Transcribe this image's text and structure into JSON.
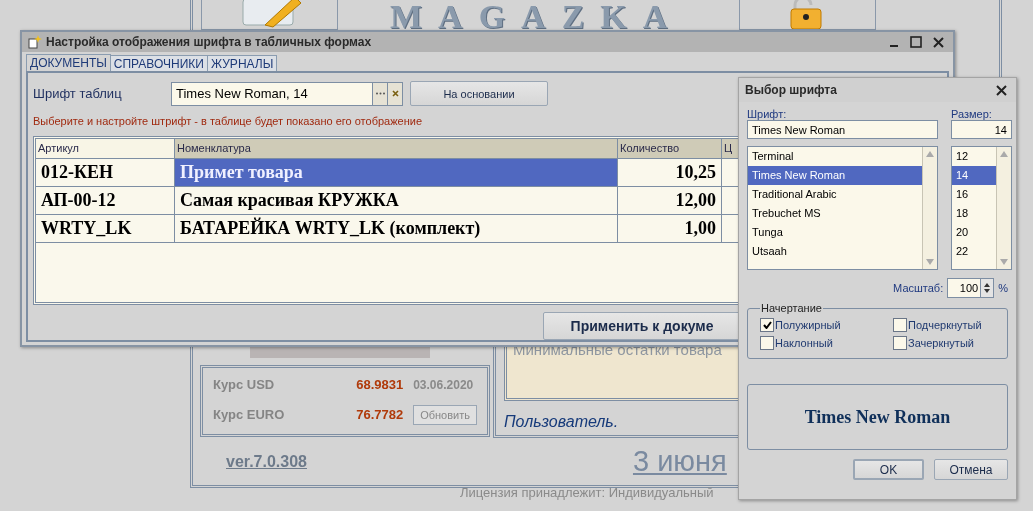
{
  "background_app": {
    "logo": "MAGAZKA",
    "currency": [
      {
        "label": "Курс USD",
        "rate": "68.9831",
        "date": "03.06.2020"
      },
      {
        "label": "Курс EURO",
        "rate": "76.7782"
      }
    ],
    "refresh_button": "Обновить",
    "notice": "Минимальные остатки товара",
    "user": "Пользователь.",
    "version": "ver.7.0.308",
    "date": "3 июня",
    "license": "Лицензия принадлежит: Индивидуальный"
  },
  "main_dialog": {
    "title": "Настройка отображения шрифта в табличных формах",
    "tabs": [
      {
        "label": "ДОКУМЕНТЫ",
        "selected": true
      },
      {
        "label": "СПРАВОЧНИКИ",
        "selected": false
      },
      {
        "label": "ЖУРНАЛЫ",
        "selected": false
      }
    ],
    "font_label": "Шрифт таблиц",
    "font_value": "Times New Roman, 14",
    "based_on_button": "На основании",
    "hint": "Выберите и настройте штрифт - в таблице будет показано его отображение",
    "table": {
      "columns": [
        "Артикул",
        "Номенклатура",
        "Количество",
        "Ц"
      ],
      "rows": [
        {
          "cells": [
            "012-КЕН",
            "Примет товара",
            "10,25"
          ],
          "selected": true
        },
        {
          "cells": [
            "АП-00-12",
            "Самая красивая КРУЖКА",
            "12,00"
          ],
          "selected": false
        },
        {
          "cells": [
            "WRTY_LK",
            "БАТАРЕЙКА WRTY_LK (комплект)",
            "1,00"
          ],
          "selected": false
        }
      ]
    },
    "apply_button": "Применить к докуме"
  },
  "font_dialog": {
    "title": "Выбор шрифта",
    "font_label": "Шрифт:",
    "font_value": "Times New Roman",
    "size_label": "Размер:",
    "size_value": "14",
    "fonts": [
      {
        "name": "Terminal",
        "selected": false
      },
      {
        "name": "Times New Roman",
        "selected": true
      },
      {
        "name": "Traditional Arabic",
        "selected": false
      },
      {
        "name": "Trebuchet MS",
        "selected": false
      },
      {
        "name": "Tunga",
        "selected": false
      },
      {
        "name": "Utsaah",
        "selected": false
      }
    ],
    "sizes": [
      {
        "value": "12",
        "selected": false
      },
      {
        "value": "14",
        "selected": true
      },
      {
        "value": "16",
        "selected": false
      },
      {
        "value": "18",
        "selected": false
      },
      {
        "value": "20",
        "selected": false
      },
      {
        "value": "22",
        "selected": false
      }
    ],
    "scale_label": "Масштаб:",
    "scale_value": "100",
    "scale_unit": "%",
    "style_group": "Начертание",
    "styles": [
      {
        "label": "Полужирный",
        "kind": "bold",
        "checked": true
      },
      {
        "label": "Подчеркнутый",
        "kind": "underline",
        "checked": false
      },
      {
        "label": "Наклонный",
        "kind": "italic",
        "checked": false
      },
      {
        "label": "Зачеркнутый",
        "kind": "strike",
        "checked": false
      }
    ],
    "preview": "Times New Roman",
    "ok_button": "OK",
    "cancel_button": "Отмена"
  }
}
